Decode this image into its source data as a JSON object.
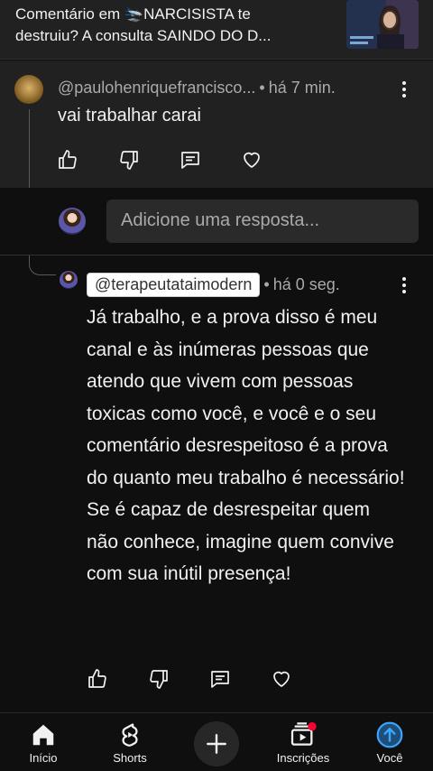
{
  "header": {
    "title_line1": "Comentário em 🛬NARCISISTA te",
    "title_line2": "destruiu? A consulta SAINDO DO D..."
  },
  "parent_comment": {
    "handle": "@paulohenriquefrancisco...",
    "time": "há 7 min.",
    "text": "vai trabalhar carai"
  },
  "reply_box": {
    "placeholder": "Adicione uma resposta..."
  },
  "reply": {
    "handle": "@terapeutataimodern",
    "time": "há 0 seg.",
    "text": "Já trabalho, e a prova disso é meu canal e às inúmeras pessoas que atendo que vivem com pessoas toxicas como você, e você e o seu comentário desrespeitoso é a prova do quanto meu trabalho é necessário! Se é capaz de desrespeitar quem não conhece, imagine quem convive com sua inútil presença!"
  },
  "navbar": {
    "items": [
      {
        "label": "Início",
        "icon": "home-icon"
      },
      {
        "label": "Shorts",
        "icon": "shorts-icon"
      },
      {
        "label": "",
        "icon": "create-icon"
      },
      {
        "label": "Inscrições",
        "icon": "subscriptions-icon"
      },
      {
        "label": "Você",
        "icon": "you-icon"
      }
    ]
  }
}
